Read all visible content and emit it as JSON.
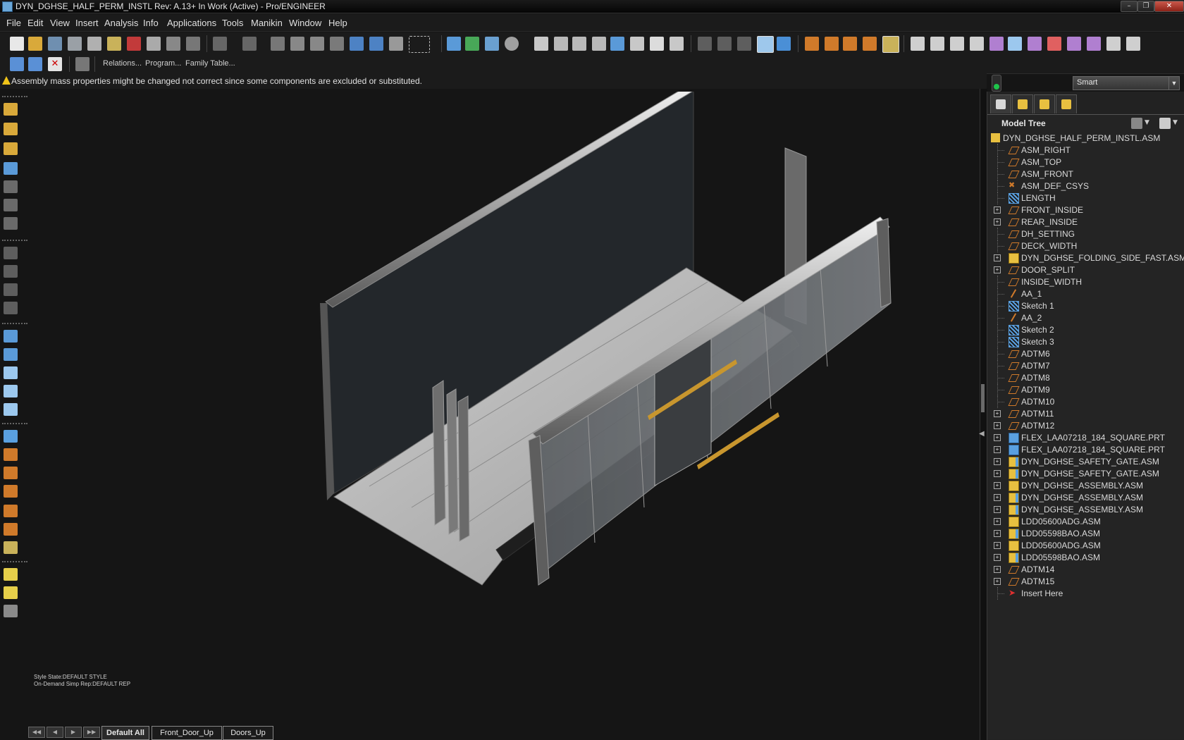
{
  "window": {
    "title": "DYN_DGHSE_HALF_PERM_INSTL Rev: A.13+ In Work  (Active) - Pro/ENGINEER"
  },
  "menu": [
    "File",
    "Edit",
    "View",
    "Insert",
    "Analysis",
    "Info",
    "Applications",
    "Tools",
    "Manikin",
    "Window",
    "Help"
  ],
  "toolbar2": {
    "relations": "Relations...",
    "program": "Program...",
    "family_table": "Family Table..."
  },
  "message": "Assembly mass properties might be changed not correct since some components are excluded or substituted.",
  "filter": {
    "value": "Smart"
  },
  "model_tree": {
    "title": "Model Tree",
    "root": "DYN_DGHSE_HALF_PERM_INSTL.ASM",
    "items": [
      {
        "label": "ASM_RIGHT",
        "icon": "datum-plane-icon",
        "expandable": false
      },
      {
        "label": "ASM_TOP",
        "icon": "datum-plane-icon",
        "expandable": false
      },
      {
        "label": "ASM_FRONT",
        "icon": "datum-plane-icon",
        "expandable": false
      },
      {
        "label": "ASM_DEF_CSYS",
        "icon": "csys-icon",
        "expandable": false
      },
      {
        "label": "LENGTH",
        "icon": "sketch-icon",
        "expandable": false
      },
      {
        "label": "FRONT_INSIDE",
        "icon": "datum-plane-icon",
        "expandable": true
      },
      {
        "label": "REAR_INSIDE",
        "icon": "datum-plane-icon",
        "expandable": true
      },
      {
        "label": "DH_SETTING",
        "icon": "datum-plane-icon",
        "expandable": false
      },
      {
        "label": "DECK_WIDTH",
        "icon": "datum-plane-icon",
        "expandable": false
      },
      {
        "label": "DYN_DGHSE_FOLDING_SIDE_FAST.ASM",
        "icon": "assembly-icon",
        "expandable": true
      },
      {
        "label": "DOOR_SPLIT",
        "icon": "datum-plane-icon",
        "expandable": true
      },
      {
        "label": "INSIDE_WIDTH",
        "icon": "datum-plane-icon",
        "expandable": false
      },
      {
        "label": "AA_1",
        "icon": "axis-icon",
        "expandable": false
      },
      {
        "label": "Sketch 1",
        "icon": "sketch-icon",
        "expandable": false
      },
      {
        "label": "AA_2",
        "icon": "axis-icon",
        "expandable": false
      },
      {
        "label": "Sketch 2",
        "icon": "sketch-icon",
        "expandable": false
      },
      {
        "label": "Sketch 3",
        "icon": "sketch-icon",
        "expandable": false
      },
      {
        "label": "ADTM6",
        "icon": "datum-plane-icon",
        "expandable": false
      },
      {
        "label": "ADTM7",
        "icon": "datum-plane-icon",
        "expandable": false
      },
      {
        "label": "ADTM8",
        "icon": "datum-plane-icon",
        "expandable": false
      },
      {
        "label": "ADTM9",
        "icon": "datum-plane-icon",
        "expandable": false
      },
      {
        "label": "ADTM10",
        "icon": "datum-plane-icon",
        "expandable": false
      },
      {
        "label": "ADTM11",
        "icon": "datum-plane-icon",
        "expandable": true
      },
      {
        "label": "ADTM12",
        "icon": "datum-plane-icon",
        "expandable": true
      },
      {
        "label": "FLEX_LAA07218_184_SQUARE.PRT",
        "icon": "flex-part-icon",
        "expandable": true
      },
      {
        "label": "FLEX_LAA07218_184_SQUARE.PRT",
        "icon": "flex-part-icon",
        "expandable": true
      },
      {
        "label": "DYN_DGHSE_SAFETY_GATE.ASM",
        "icon": "flex-assembly-icon",
        "expandable": true
      },
      {
        "label": "DYN_DGHSE_SAFETY_GATE.ASM",
        "icon": "flex-assembly-icon",
        "expandable": true
      },
      {
        "label": "DYN_DGHSE_ASSEMBLY.ASM",
        "icon": "assembly-icon",
        "expandable": true
      },
      {
        "label": "DYN_DGHSE_ASSEMBLY.ASM",
        "icon": "flex-assembly-icon",
        "expandable": true
      },
      {
        "label": "DYN_DGHSE_ASSEMBLY.ASM",
        "icon": "flex-assembly-icon",
        "expandable": true
      },
      {
        "label": "LDD05600ADG.ASM",
        "icon": "assembly-icon",
        "expandable": true
      },
      {
        "label": "LDD05598BAO.ASM",
        "icon": "flex-assembly-icon",
        "expandable": true
      },
      {
        "label": "LDD05600ADG.ASM",
        "icon": "assembly-icon",
        "expandable": true
      },
      {
        "label": "LDD05598BAO.ASM",
        "icon": "flex-assembly-icon",
        "expandable": true
      },
      {
        "label": "ADTM14",
        "icon": "datum-plane-icon",
        "expandable": true
      },
      {
        "label": "ADTM15",
        "icon": "datum-plane-icon",
        "expandable": true
      },
      {
        "label": "Insert Here",
        "icon": "insert-here-icon",
        "expandable": false
      }
    ]
  },
  "graphics": {
    "style_state": "Style State:DEFAULT STYLE",
    "simp_rep": "On-Demand Simp Rep:DEFAULT REP"
  },
  "view_tabs": [
    "Default All",
    "Front_Door_Up",
    "Doors_Up"
  ],
  "colors": {
    "background": "#151515",
    "datum_plane": "#d07a2a",
    "sketch": "#5aa0e0",
    "assembly": "#e8c040",
    "warning": "#f0c419"
  }
}
